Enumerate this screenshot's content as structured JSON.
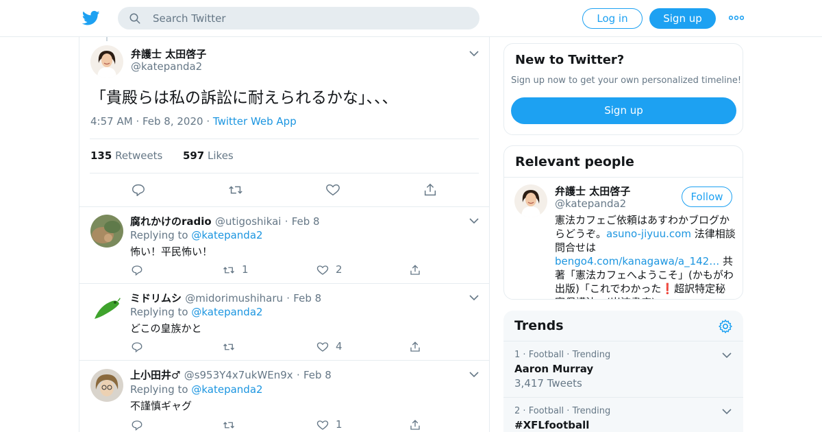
{
  "topbar": {
    "search_placeholder": "Search Twitter",
    "login_label": "Log in",
    "signup_label": "Sign up"
  },
  "tweet": {
    "author_name": "弁護士 太田啓子",
    "author_handle": "@katepanda2",
    "text": "「貴殿らは私の訴訟に耐えられるかな」、、、",
    "time": "4:57 AM",
    "date": "Feb 8, 2020",
    "source": "Twitter Web App",
    "retweets_count": "135",
    "retweets_label": "Retweets",
    "likes_count": "597",
    "likes_label": "Likes"
  },
  "replies": [
    {
      "name": "腐れかけのradio",
      "handle": "@utigoshikai",
      "date": "Feb 8",
      "replying_prefix": "Replying to",
      "replying_to": "@katepanda2",
      "text": "怖い！平民怖い！",
      "retweets": "1",
      "likes": "2"
    },
    {
      "name": "ミドリムシ",
      "handle": "@midorimushiharu",
      "date": "Feb 8",
      "replying_prefix": "Replying to",
      "replying_to": "@katepanda2",
      "text": "どこの皇族かと",
      "retweets": "",
      "likes": "4"
    },
    {
      "name": "上小田井♂",
      "handle": "@s953Y4x7ukWEn9x",
      "date": "Feb 8",
      "replying_prefix": "Replying to",
      "replying_to": "@katepanda2",
      "text": "不謹慎ギャグ",
      "retweets": "",
      "likes": "1"
    }
  ],
  "new_to_twitter": {
    "title": "New to Twitter?",
    "subtitle": "Sign up now to get your own personalized timeline!",
    "signup_label": "Sign up"
  },
  "relevant_people": {
    "title": "Relevant people",
    "name": "弁護士 太田啓子",
    "handle": "@katepanda2",
    "follow_label": "Follow",
    "bio_1": "憲法カフェご依頼はあすわかブログからどうぞ。",
    "bio_link_1": "asuno-jiyuu.com",
    "bio_2": " 法律相談問合せは",
    "bio_link_2": "bengo4.com/kanagawa/a_142…",
    "bio_3": " 共著「憲法カフェへようこそ」(かもがわ出版)「これでわかった❗️超訳特定秘密保護法」(岩波書店)。"
  },
  "trends": {
    "title": "Trends",
    "items": [
      {
        "rank": "1",
        "category": "Football",
        "status": "Trending",
        "name": "Aaron Murray",
        "count": "3,417 Tweets"
      },
      {
        "rank": "2",
        "category": "Football",
        "status": "Trending",
        "name": "#XFLfootball",
        "count": ""
      }
    ]
  },
  "colors": {
    "accent": "#1da1f2",
    "link": "#1b95e0",
    "muted": "#657786",
    "border": "#e6ecf0"
  }
}
